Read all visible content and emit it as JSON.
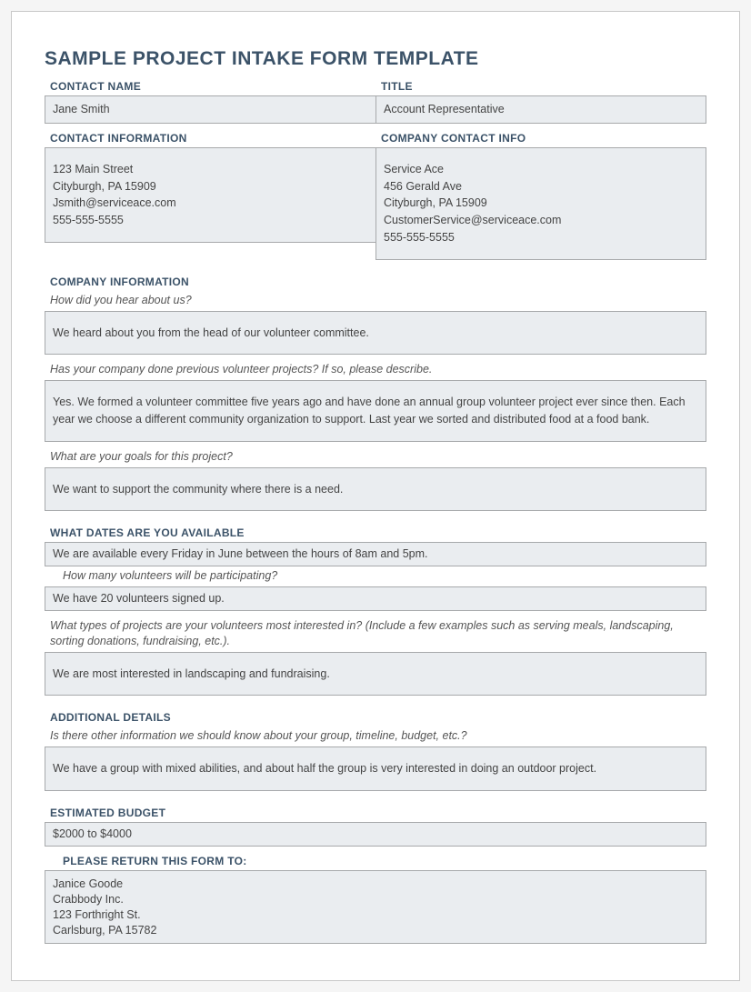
{
  "title": "SAMPLE PROJECT INTAKE FORM TEMPLATE",
  "contact": {
    "name_label": "CONTACT NAME",
    "name_value": "Jane Smith",
    "title_label": "TITLE",
    "title_value": "Account Representative",
    "info_label": "CONTACT INFORMATION",
    "info_value": "123 Main Street\nCityburgh, PA 15909\nJsmith@serviceace.com\n555-555-5555",
    "company_info_label": "COMPANY CONTACT INFO",
    "company_info_value": "Service Ace\n456 Gerald Ave\nCityburgh, PA 15909\nCustomerService@serviceace.com\n555-555-5555"
  },
  "company_info_section": {
    "header": "COMPANY INFORMATION",
    "q1_prompt": "How did you hear about us?",
    "q1_answer": "We heard about you from the head of our volunteer committee.",
    "q2_prompt": "Has your company done previous volunteer projects? If so, please describe.",
    "q2_answer": "Yes. We formed a volunteer committee five years ago and have done an annual group volunteer project ever since then. Each year we choose a different community organization to support. Last year we sorted and distributed food at a food bank.",
    "q3_prompt": "What are your goals for this project?",
    "q3_answer": "We want to support the community where there is a need."
  },
  "dates_section": {
    "header": "WHAT DATES ARE YOU AVAILABLE",
    "answer1": "We are available every Friday in June between the hours of 8am and 5pm.",
    "q2_prompt": "How many volunteers will be participating?",
    "answer2": "We have 20 volunteers signed up.",
    "q3_prompt": "What types of projects are your volunteers most interested in? (Include a few examples such as serving meals, landscaping, sorting donations, fundraising, etc.).",
    "answer3": "We are most interested in landscaping and fundraising."
  },
  "additional_section": {
    "header": "ADDITIONAL DETAILS",
    "prompt": "Is there other information we should know about your group, timeline, budget, etc.?",
    "answer": "We have a group with mixed abilities, and about half the group is very interested in doing an outdoor project."
  },
  "budget_section": {
    "header": "ESTIMATED BUDGET",
    "value": "$2000 to $4000"
  },
  "return_section": {
    "header": "PLEASE RETURN THIS FORM TO:",
    "value": "Janice Goode\nCrabbody Inc.\n123 Forthright St.\nCarlsburg, PA 15782"
  }
}
